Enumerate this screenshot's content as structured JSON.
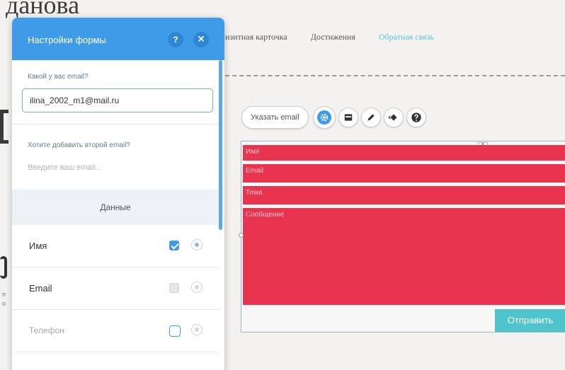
{
  "site": {
    "title": "данова",
    "nav": [
      {
        "label": "изитная карточка",
        "active": false
      },
      {
        "label": "Достижения",
        "active": false
      },
      {
        "label": "Обратная связь",
        "active": true
      }
    ],
    "edge_text": [
      "п",
      "о"
    ]
  },
  "toolbar": {
    "email_label": "Указать email",
    "buttons": [
      "gear-icon",
      "layout-icon",
      "pen-icon",
      "animation-icon",
      "help-icon"
    ]
  },
  "form_widget": {
    "fields": [
      "Имя",
      "Email",
      "Тема",
      "Сообщение"
    ],
    "submit_label": "Отправить",
    "colors": {
      "field": "#e8344f",
      "submit": "#4ec5cd"
    }
  },
  "panel": {
    "title": "Настройки формы",
    "help_label": "?",
    "close_label": "×",
    "email_question": "Какой у вас email?",
    "email_value": "ilina_2002_m1@mail.ru",
    "second_email_question": "Хотите добавить второй email?",
    "second_email_placeholder": "Введите ваш email...",
    "section_title": "Данные",
    "rows": [
      {
        "label": "Имя",
        "checked": true,
        "enabled": true
      },
      {
        "label": "Email",
        "checked": true,
        "enabled": false
      },
      {
        "label": "Телефон",
        "checked": false,
        "enabled": true
      }
    ],
    "accent": "#3f9be8"
  }
}
